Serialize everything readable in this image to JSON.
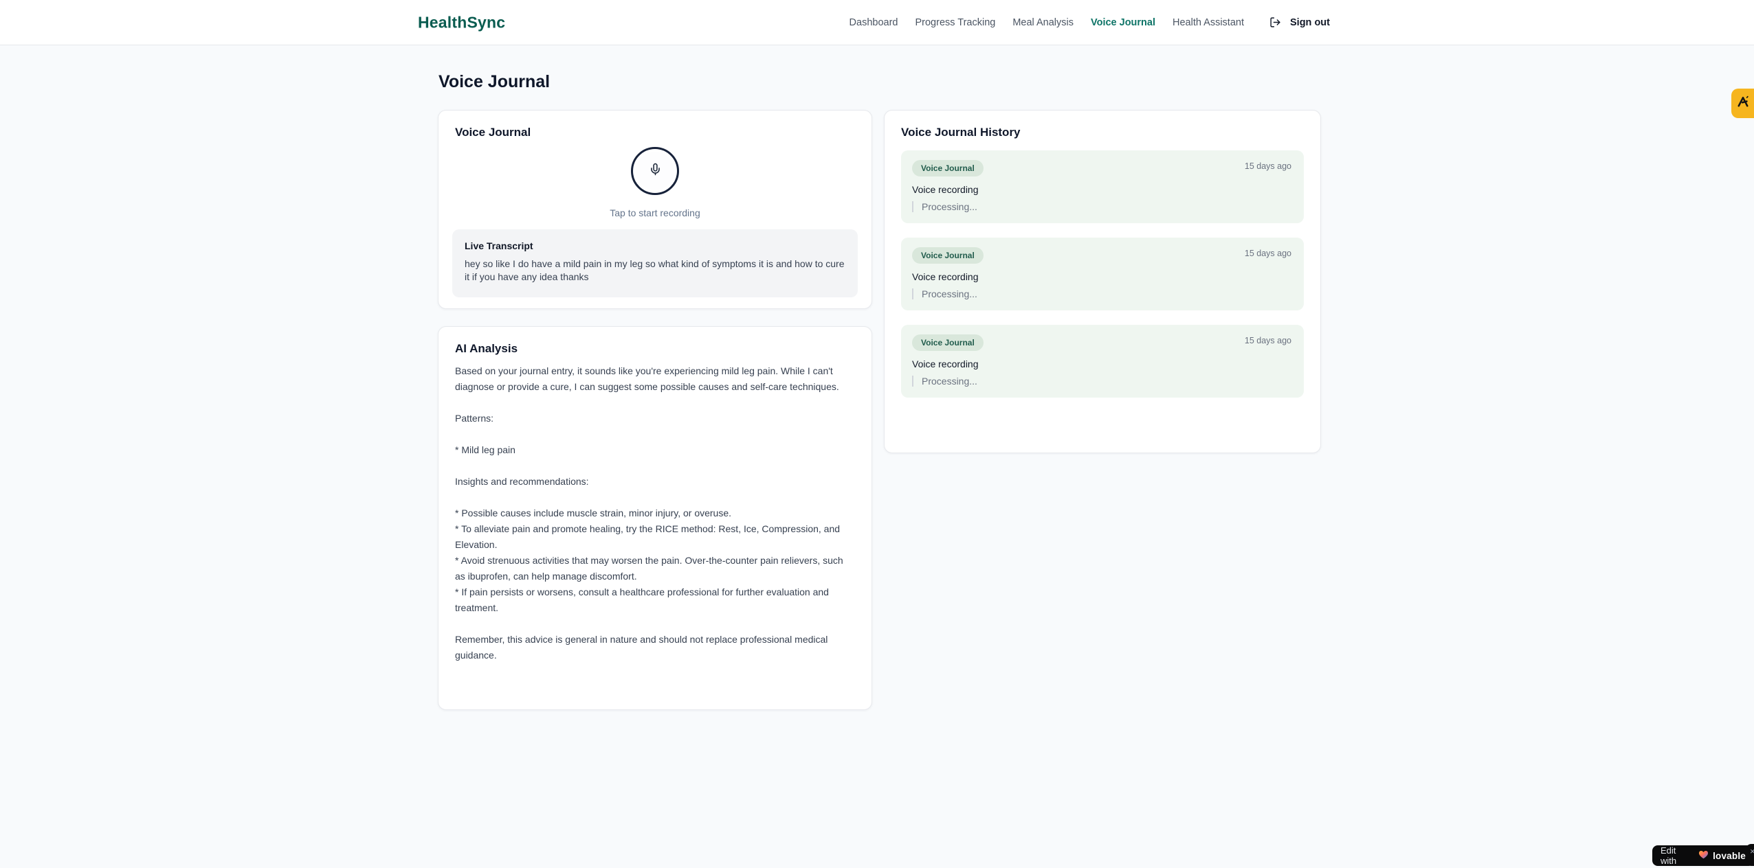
{
  "colors": {
    "brand_teal": "#0a5c50",
    "nav_active_teal": "#0e7467",
    "page_background": "#f8fafc",
    "history_entry_background": "#eff6f0",
    "badge_background": "#d9e7db",
    "badge_text": "#215c4c",
    "side_tab_amber": "#f6b51f",
    "lovable_black": "#0b0b0c"
  },
  "header": {
    "brand": "HealthSync",
    "nav": [
      {
        "label": "Dashboard"
      },
      {
        "label": "Progress Tracking"
      },
      {
        "label": "Meal Analysis"
      },
      {
        "label": "Voice Journal",
        "active": true
      },
      {
        "label": "Health Assistant"
      }
    ],
    "sign_out": {
      "label": "Sign out",
      "icon": "logout-icon"
    }
  },
  "page": {
    "title": "Voice Journal"
  },
  "recorder": {
    "title": "Voice Journal",
    "mic_icon": "mic-icon",
    "tap_label": "Tap to start recording",
    "live_transcript_title": "Live Transcript",
    "live_transcript_text": "hey so like I do have a mild pain in my leg so what kind of symptoms it is and how to cure it if you have any idea thanks"
  },
  "analysis": {
    "title": "AI Analysis",
    "body": "Based on your journal entry, it sounds like you're experiencing mild leg pain. While I can't diagnose or provide a cure, I can suggest some possible causes and self-care techniques.\n\nPatterns:\n\n* Mild leg pain\n\nInsights and recommendations:\n\n* Possible causes include muscle strain, minor injury, or overuse.\n* To alleviate pain and promote healing, try the RICE method: Rest, Ice, Compression, and Elevation.\n* Avoid strenuous activities that may worsen the pain. Over-the-counter pain relievers, such as ibuprofen, can help manage discomfort.\n* If pain persists or worsens, consult a healthcare professional for further evaluation and treatment.\n\nRemember, this advice is general in nature and should not replace professional medical guidance."
  },
  "history": {
    "title": "Voice Journal History",
    "entries": [
      {
        "badge": "Voice Journal",
        "time": "15 days ago",
        "title": "Voice recording",
        "status": "Processing..."
      },
      {
        "badge": "Voice Journal",
        "time": "15 days ago",
        "title": "Voice recording",
        "status": "Processing..."
      },
      {
        "badge": "Voice Journal",
        "time": "15 days ago",
        "title": "Voice recording",
        "status": "Processing..."
      }
    ]
  },
  "side_tab": {
    "icon": "amber-logo-icon"
  },
  "lovable_badge": {
    "prefix": "Edit with",
    "brand": "lovable",
    "heart_icon": "heart-icon",
    "close": "×"
  }
}
